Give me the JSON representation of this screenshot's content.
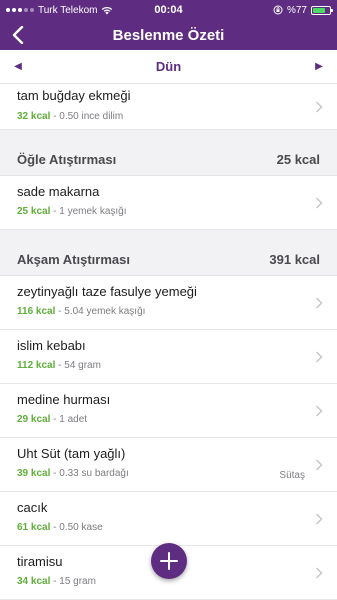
{
  "status": {
    "carrier": "Turk Telekom",
    "time": "00:04",
    "battery": "%77",
    "battery_level": 0.77
  },
  "header": {
    "title": "Beslenme Özeti"
  },
  "datebar": {
    "label": "Dün"
  },
  "colors": {
    "brand": "#5e2d82",
    "kcal": "#5fae3a"
  },
  "top_items": [
    {
      "name": "tam buğday ekmeği",
      "kcal": "32 kcal",
      "portion": " - 0.50 ince dilim"
    }
  ],
  "sections": [
    {
      "title": "Öğle Atıştırması",
      "total": "25 kcal",
      "items": [
        {
          "name": "sade makarna",
          "kcal": "25 kcal",
          "portion": " - 1 yemek kaşığı"
        }
      ]
    },
    {
      "title": "Akşam Atıştırması",
      "total": "391 kcal",
      "items": [
        {
          "name": "zeytinyağlı taze fasulye yemeği",
          "kcal": "116 kcal",
          "portion": " - 5.04 yemek kaşığı"
        },
        {
          "name": "islim kebabı",
          "kcal": "112 kcal",
          "portion": " - 54 gram"
        },
        {
          "name": "medine hurması",
          "kcal": "29 kcal",
          "portion": " - 1 adet"
        },
        {
          "name": "Uht Süt (tam yağlı)",
          "kcal": "39 kcal",
          "portion": " - 0.33 su bardağı",
          "brand": "Sütaş"
        },
        {
          "name": "cacık",
          "kcal": "61 kcal",
          "portion": " - 0.50 kase"
        },
        {
          "name": "tiramisu",
          "kcal": "34 kcal",
          "portion": " - 15 gram"
        }
      ]
    }
  ]
}
